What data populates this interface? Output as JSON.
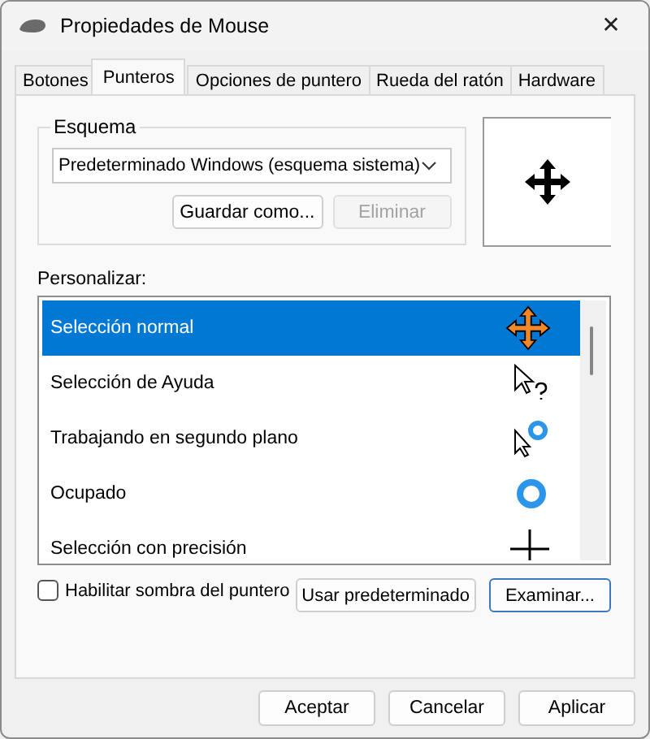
{
  "window": {
    "title": "Propiedades de Mouse",
    "close": "✕"
  },
  "tabs": [
    {
      "label": "Botones",
      "selected": false
    },
    {
      "label": "Punteros",
      "selected": true
    },
    {
      "label": "Opciones de puntero",
      "selected": false
    },
    {
      "label": "Rueda del ratón",
      "selected": false
    },
    {
      "label": "Hardware",
      "selected": false
    }
  ],
  "scheme": {
    "label": "Esquema",
    "value": "Predeterminado Windows (esquema sistema)",
    "buttons": [
      {
        "label": "Guardar como...",
        "disabled": false
      },
      {
        "label": "Eliminar",
        "disabled": true
      }
    ]
  },
  "customize": {
    "label": "Personalizar:",
    "items": [
      {
        "label": "Selección normal",
        "kind": "move",
        "selected": true
      },
      {
        "label": "Selección de Ayuda",
        "kind": "help",
        "selected": false
      },
      {
        "label": "Trabajando en segundo plano",
        "kind": "working",
        "selected": false
      },
      {
        "label": "Ocupado",
        "kind": "busy",
        "selected": false
      },
      {
        "label": "Selección con precisión",
        "kind": "precision",
        "selected": false
      }
    ]
  },
  "shadow": {
    "label": "Habilitar sombra del puntero",
    "checked": false
  },
  "actions": [
    {
      "label": "Usar predeterminado",
      "default": false
    },
    {
      "label": "Examinar...",
      "default": true
    }
  ],
  "footer": [
    {
      "label": "Aceptar",
      "default": false
    },
    {
      "label": "Cancelar",
      "default": false
    },
    {
      "label": "Aplicar",
      "default": false
    }
  ]
}
